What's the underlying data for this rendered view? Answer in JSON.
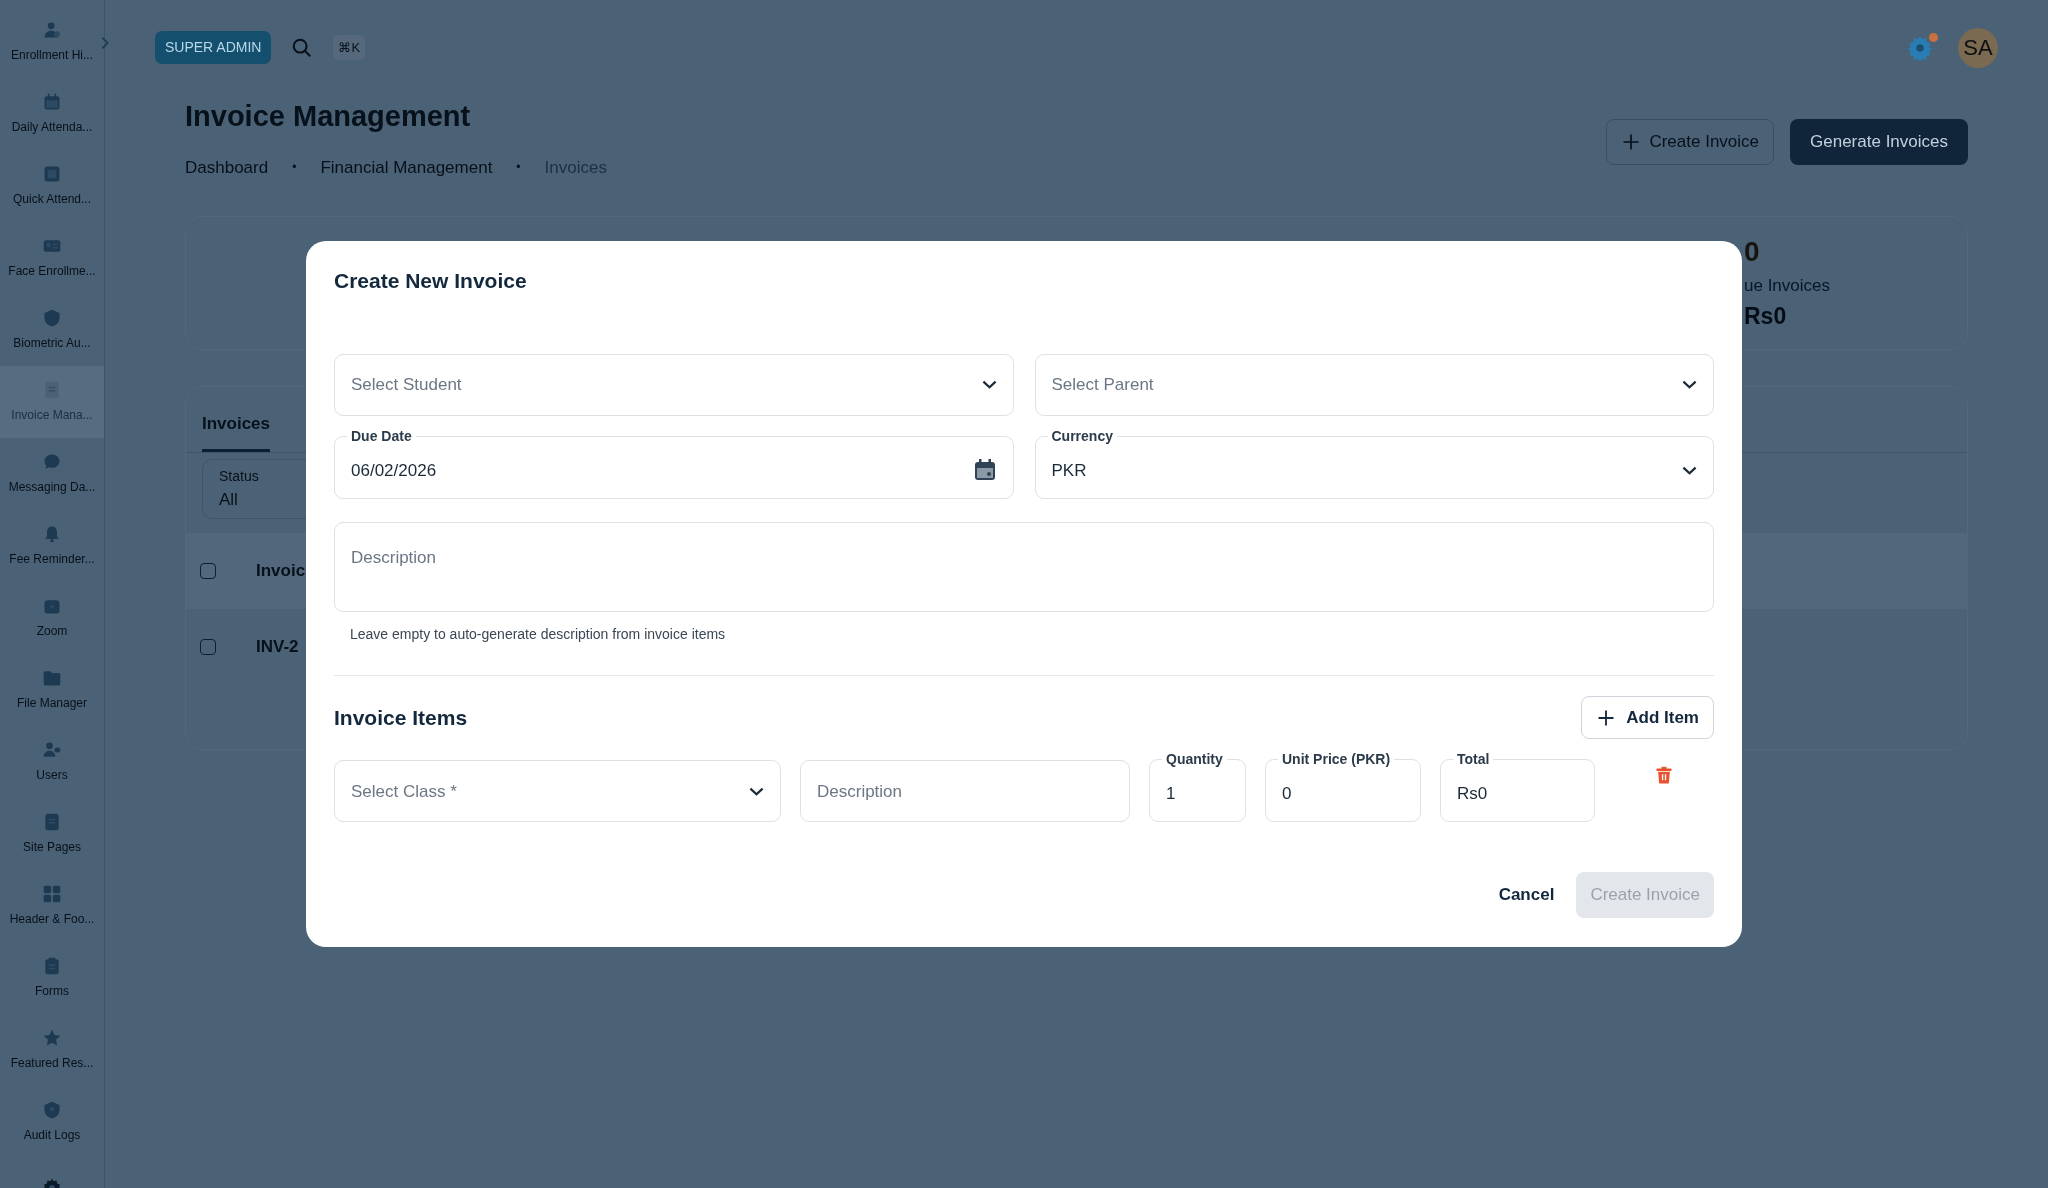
{
  "sidebar": {
    "items": [
      {
        "label": "Enrollment Hi...",
        "selected": false
      },
      {
        "label": "Daily Attenda...",
        "selected": false
      },
      {
        "label": "Quick Attend...",
        "selected": false
      },
      {
        "label": "Face Enrollme...",
        "selected": false
      },
      {
        "label": "Biometric Au...",
        "selected": false
      },
      {
        "label": "Invoice Mana...",
        "selected": true
      },
      {
        "label": "Messaging Da...",
        "selected": false
      },
      {
        "label": "Fee Reminder...",
        "selected": false
      },
      {
        "label": "Zoom",
        "selected": false
      },
      {
        "label": "File Manager",
        "selected": false
      },
      {
        "label": "Users",
        "selected": false
      },
      {
        "label": "Site Pages",
        "selected": false
      },
      {
        "label": "Header & Foo...",
        "selected": false
      },
      {
        "label": "Forms",
        "selected": false
      },
      {
        "label": "Featured Res...",
        "selected": false
      },
      {
        "label": "Audit Logs",
        "selected": false
      }
    ]
  },
  "topbar": {
    "role_badge": "SUPER ADMIN",
    "shortcut": "⌘K",
    "has_notification": true,
    "avatar": "SA"
  },
  "page": {
    "title": "Invoice Management",
    "breadcrumb_separator": "•",
    "breadcrumbs": [
      {
        "label": "Dashboard",
        "current": false
      },
      {
        "label": "Financial Management",
        "current": false
      },
      {
        "label": "Invoices",
        "current": true
      }
    ],
    "actions": [
      {
        "label": "Create Invoice",
        "kind": "outline"
      },
      {
        "label": "Generate Invoices",
        "kind": "primary"
      }
    ]
  },
  "stats": {
    "value": "0",
    "label": "ue Invoices",
    "amount": "Rs0"
  },
  "invoices_panel": {
    "tabs": [
      {
        "label": "Invoices",
        "selected": true
      }
    ],
    "filter": {
      "label": "Status",
      "value": "All"
    },
    "table": {
      "header": {
        "text": "Invoic",
        "checked": false
      },
      "rows": [
        {
          "text": "INV-2",
          "checked": false
        }
      ]
    }
  },
  "modal": {
    "title": "Create New Invoice",
    "fields": [
      {
        "kind": "select",
        "placeholder": "Select Student"
      },
      {
        "kind": "select",
        "placeholder": "Select Parent"
      },
      {
        "kind": "date",
        "label": "Due Date",
        "value": "06/02/2026"
      },
      {
        "kind": "select",
        "label": "Currency",
        "value": "PKR"
      }
    ],
    "description": {
      "placeholder": "Description",
      "helper": "Leave empty to auto-generate description from invoice items"
    },
    "items_title": "Invoice Items",
    "add_button": "Add Item",
    "item_fields": [
      {
        "kind": "select",
        "placeholder": "Select Class *"
      },
      {
        "kind": "text",
        "placeholder": "Description"
      },
      {
        "kind": "text",
        "label": "Quantity",
        "value": "1"
      },
      {
        "kind": "text",
        "label": "Unit Price (PKR)",
        "value": "0"
      },
      {
        "kind": "text",
        "label": "Total",
        "value": "Rs0"
      }
    ],
    "cancel": "Cancel",
    "submit": {
      "label": "Create Invoice",
      "disabled": true
    }
  }
}
